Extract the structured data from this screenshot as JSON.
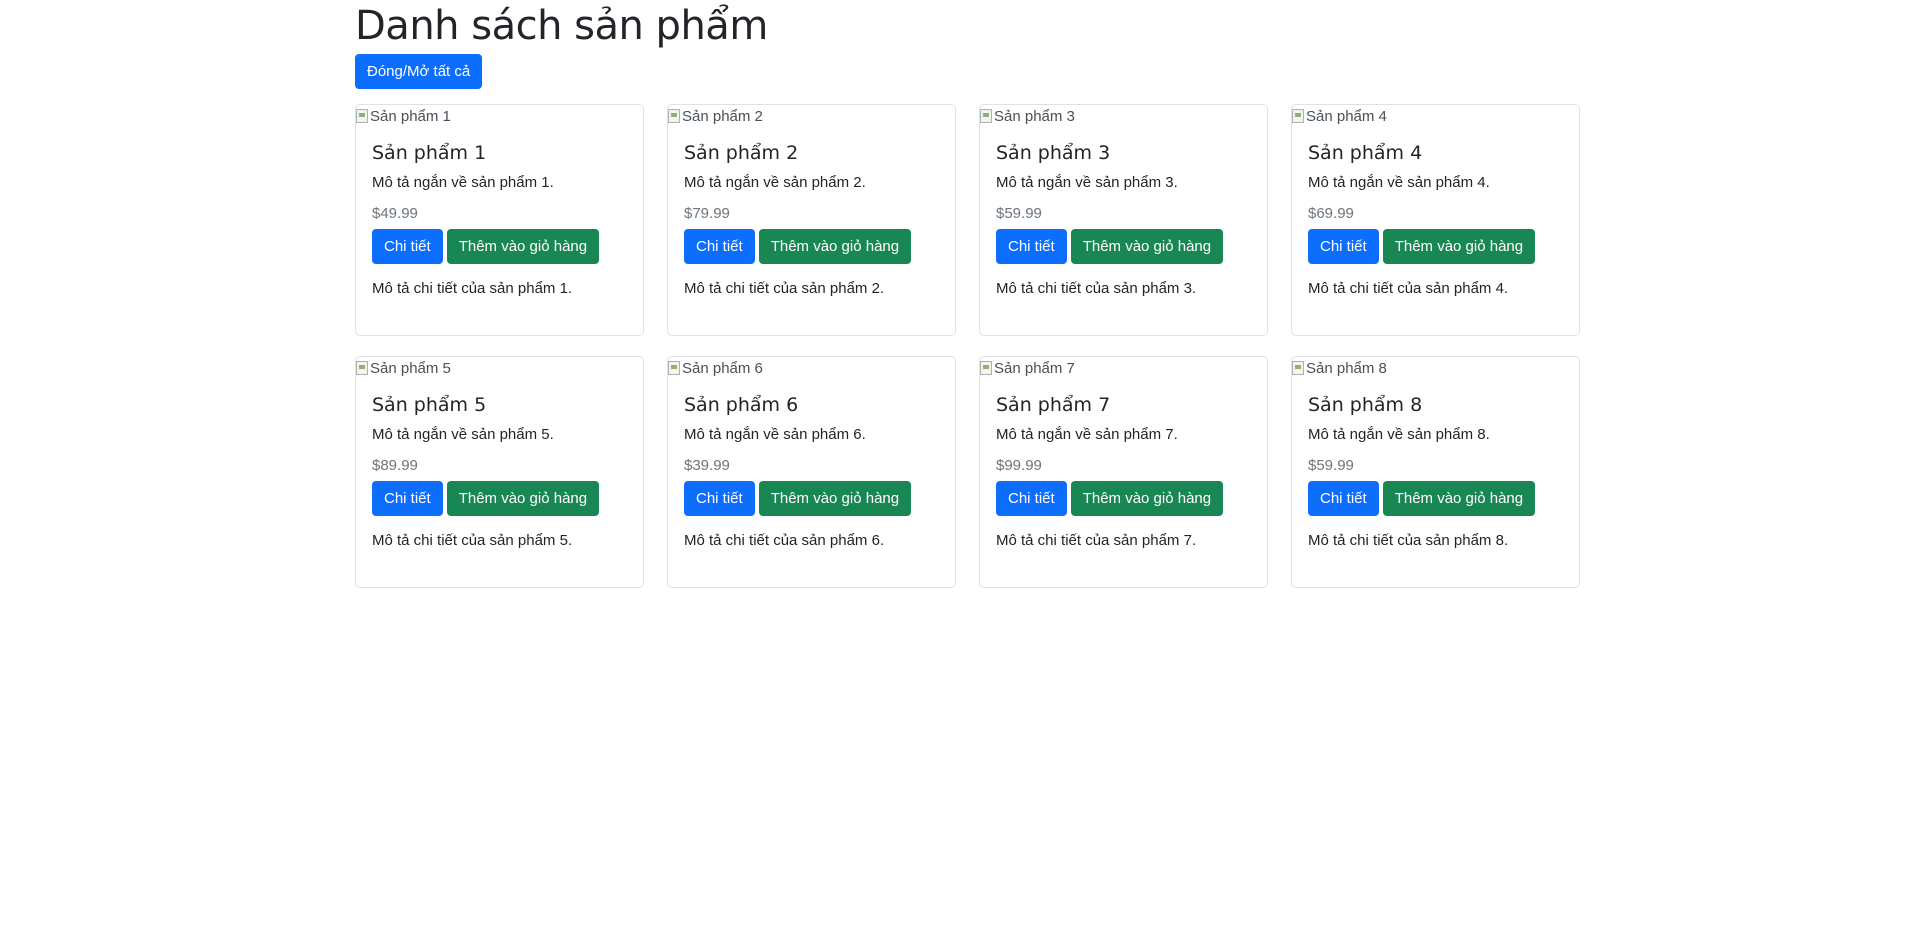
{
  "page": {
    "title": "Danh sách sản phẩm",
    "toggle_all_label": "Đóng/Mở tất cả"
  },
  "colors": {
    "primary": "#0d6efd",
    "success": "#198754",
    "muted": "#6c757d"
  },
  "products": [
    {
      "image_alt": "Sản phẩm 1",
      "name": "Sản phẩm 1",
      "short_desc": "Mô tả ngắn về sản phẩm 1.",
      "price": "$49.99",
      "detail_label": "Chi tiết",
      "add_to_cart_label": "Thêm vào giỏ hàng",
      "long_desc": "Mô tả chi tiết của sản phẩm 1."
    },
    {
      "image_alt": "Sản phẩm 2",
      "name": "Sản phẩm 2",
      "short_desc": "Mô tả ngắn về sản phẩm 2.",
      "price": "$79.99",
      "detail_label": "Chi tiết",
      "add_to_cart_label": "Thêm vào giỏ hàng",
      "long_desc": "Mô tả chi tiết của sản phẩm 2."
    },
    {
      "image_alt": "Sản phẩm 3",
      "name": "Sản phẩm 3",
      "short_desc": "Mô tả ngắn về sản phẩm 3.",
      "price": "$59.99",
      "detail_label": "Chi tiết",
      "add_to_cart_label": "Thêm vào giỏ hàng",
      "long_desc": "Mô tả chi tiết của sản phẩm 3."
    },
    {
      "image_alt": "Sản phẩm 4",
      "name": "Sản phẩm 4",
      "short_desc": "Mô tả ngắn về sản phẩm 4.",
      "price": "$69.99",
      "detail_label": "Chi tiết",
      "add_to_cart_label": "Thêm vào giỏ hàng",
      "long_desc": "Mô tả chi tiết của sản phẩm 4."
    },
    {
      "image_alt": "Sản phẩm 5",
      "name": "Sản phẩm 5",
      "short_desc": "Mô tả ngắn về sản phẩm 5.",
      "price": "$89.99",
      "detail_label": "Chi tiết",
      "add_to_cart_label": "Thêm vào giỏ hàng",
      "long_desc": "Mô tả chi tiết của sản phẩm 5."
    },
    {
      "image_alt": "Sản phẩm 6",
      "name": "Sản phẩm 6",
      "short_desc": "Mô tả ngắn về sản phẩm 6.",
      "price": "$39.99",
      "detail_label": "Chi tiết",
      "add_to_cart_label": "Thêm vào giỏ hàng",
      "long_desc": "Mô tả chi tiết của sản phẩm 6."
    },
    {
      "image_alt": "Sản phẩm 7",
      "name": "Sản phẩm 7",
      "short_desc": "Mô tả ngắn về sản phẩm 7.",
      "price": "$99.99",
      "detail_label": "Chi tiết",
      "add_to_cart_label": "Thêm vào giỏ hàng",
      "long_desc": "Mô tả chi tiết của sản phẩm 7."
    },
    {
      "image_alt": "Sản phẩm 8",
      "name": "Sản phẩm 8",
      "short_desc": "Mô tả ngắn về sản phẩm 8.",
      "price": "$59.99",
      "detail_label": "Chi tiết",
      "add_to_cart_label": "Thêm vào giỏ hàng",
      "long_desc": "Mô tả chi tiết của sản phẩm 8."
    }
  ]
}
